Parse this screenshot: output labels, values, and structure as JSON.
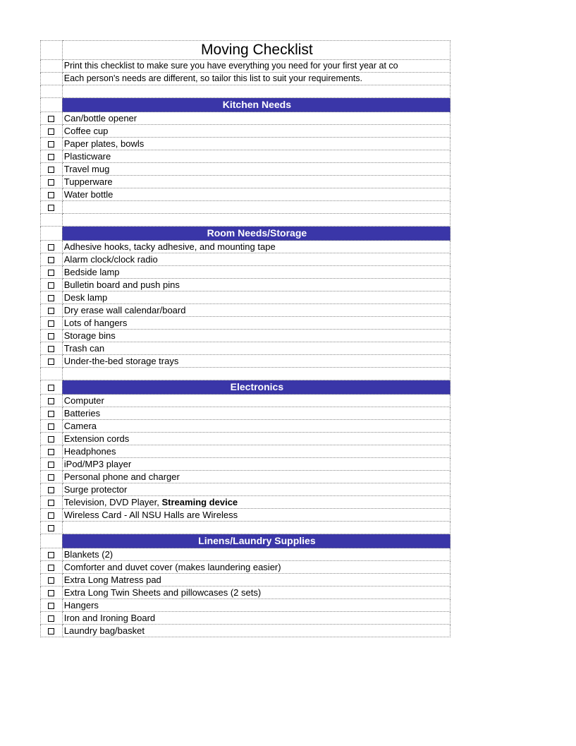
{
  "title": "Moving Checklist",
  "description": [
    "Print this checklist to make sure you have everything you need for your first year at co",
    "Each person's needs are different, so tailor this list to suit your requirements."
  ],
  "sections": [
    {
      "name": "Kitchen Needs",
      "header_has_checkbox": false,
      "items": [
        "Can/bottle opener",
        "Coffee cup",
        "Paper plates, bowls",
        "Plasticware",
        "Travel mug",
        "Tupperware",
        "Water bottle",
        ""
      ],
      "spacer_after": true
    },
    {
      "name": "Room Needs/Storage",
      "header_has_checkbox": false,
      "items": [
        "Adhesive hooks, tacky adhesive, and mounting tape",
        "Alarm clock/clock radio",
        "Bedside lamp",
        "Bulletin board and push pins",
        "Desk lamp",
        "Dry erase wall calendar/board",
        "Lots of hangers",
        "Storage bins",
        "Trash can",
        "Under-the-bed storage trays"
      ],
      "spacer_after": true
    },
    {
      "name": "Electronics",
      "header_has_checkbox": true,
      "items": [
        "Computer",
        "Batteries",
        "Camera",
        "Extension cords",
        "Headphones",
        "iPod/MP3 player",
        "Personal phone and charger",
        "Surge protector",
        {
          "prefix": "Television, DVD Player, ",
          "bold": "Streaming device"
        },
        "Wireless Card - All NSU Halls are Wireless",
        ""
      ],
      "spacer_after": false
    },
    {
      "name": "Linens/Laundry Supplies",
      "header_has_checkbox": false,
      "items": [
        "Blankets (2)",
        "Comforter and duvet cover (makes laundering easier)",
        "Extra Long Matress pad",
        "Extra Long Twin Sheets and pillowcases (2 sets)",
        "Hangers",
        "Iron and Ironing Board",
        "Laundry bag/basket"
      ],
      "spacer_after": false
    }
  ]
}
